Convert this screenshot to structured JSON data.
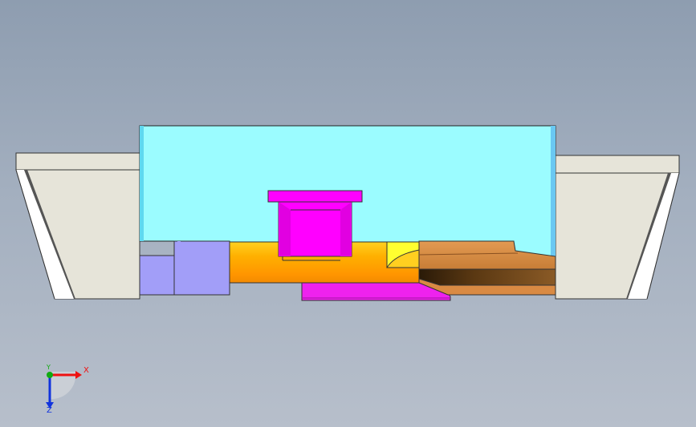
{
  "viewport": {
    "background_top": "#8e9db0",
    "background_bottom": "#b7bfcb"
  },
  "model": {
    "components": [
      {
        "name": "left-clamp-block",
        "color": "#e6e4d8"
      },
      {
        "name": "right-clamp-block",
        "color": "#e6e4d8"
      },
      {
        "name": "mold-housing",
        "color": "#99fbff"
      },
      {
        "name": "magenta-top-insert",
        "color": "#ff00ff"
      },
      {
        "name": "magenta-bottom-plate",
        "color": "#ee22ee"
      },
      {
        "name": "orange-core-rod",
        "color": "#ffae00"
      },
      {
        "name": "lavender-slider",
        "color": "#a09cf8"
      },
      {
        "name": "brown-wedge-slider",
        "color": "#c88844"
      },
      {
        "name": "yellow-insert",
        "color": "#ffff30"
      }
    ]
  },
  "triad": {
    "x_label": "X",
    "y_label": "Y",
    "z_label": "Z",
    "x_color": "#ee1111",
    "y_color": "#11aa11",
    "z_color": "#1133dd"
  }
}
